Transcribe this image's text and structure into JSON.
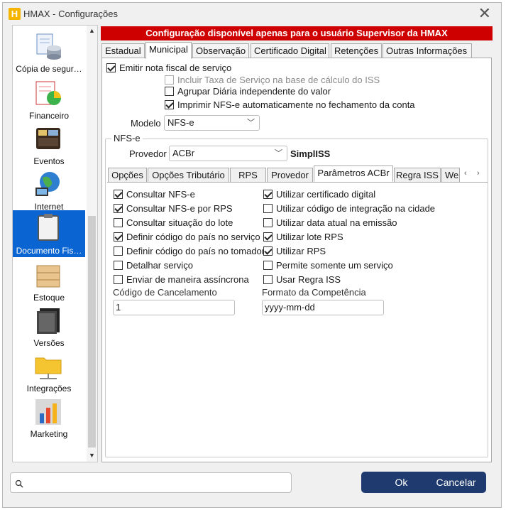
{
  "window": {
    "title": "HMAX - Configurações",
    "app_icon_letter": "H"
  },
  "sidebar": {
    "items": [
      {
        "label": "Cópia de segur…",
        "icon": "database-backup-icon"
      },
      {
        "label": "Financeiro",
        "icon": "finance-chart-icon"
      },
      {
        "label": "Eventos",
        "icon": "wallet-icon"
      },
      {
        "label": "Internet",
        "icon": "globe-computer-icon"
      },
      {
        "label": "Documento Fis…",
        "icon": "clipboard-icon",
        "active": true
      },
      {
        "label": "Estoque",
        "icon": "box-icon"
      },
      {
        "label": "Versões",
        "icon": "versions-icon"
      },
      {
        "label": "Integrações",
        "icon": "folder-network-icon"
      },
      {
        "label": "Marketing",
        "icon": "marketing-chart-icon"
      }
    ]
  },
  "banner": "Configuração disponível apenas para o usuário Supervisor da HMAX",
  "top_tabs": [
    "Estadual",
    "Municipal",
    "Observação",
    "Certificado Digital",
    "Retenções",
    "Outras Informações"
  ],
  "top_tabs_active": "Municipal",
  "municipal": {
    "emitir": {
      "label": "Emitir nota fiscal de serviço",
      "checked": true
    },
    "incluir_taxa": {
      "label": "Incluir Taxa de Serviço na base de cálculo do ISS",
      "checked": false,
      "disabled": true
    },
    "agrupar": {
      "label": "Agrupar Diária independente do valor",
      "checked": false
    },
    "imprimir": {
      "label": "Imprimir NFS-e automaticamente no fechamento da conta",
      "checked": true
    },
    "modelo_label": "Modelo",
    "modelo_value": "NFS-e"
  },
  "nfse": {
    "group_title": "NFS-e",
    "provedor_label": "Provedor",
    "provedor_value": "ACBr",
    "provedor_name": "SimplISS",
    "tabs": [
      "Opções",
      "Opções Tributário",
      "RPS",
      "Provedor",
      "Parâmetros ACBr",
      "Regra ISS",
      "We"
    ],
    "tabs_active": "Parâmetros ACBr",
    "left_checks": [
      {
        "label": "Consultar NFS-e",
        "checked": true
      },
      {
        "label": "Consultar NFS-e por RPS",
        "checked": true
      },
      {
        "label": "Consultar situação do lote",
        "checked": false
      },
      {
        "label": "Definir código do país no serviço",
        "checked": true
      },
      {
        "label": "Definir código do país no tomador",
        "checked": false
      },
      {
        "label": "Detalhar serviço",
        "checked": false
      },
      {
        "label": "Enviar de maneira assíncrona",
        "checked": false
      }
    ],
    "right_checks": [
      {
        "label": "Utilizar certificado digital",
        "checked": true
      },
      {
        "label": "Utilizar código de integração na cidade",
        "checked": false
      },
      {
        "label": "Utilizar data atual na emissão",
        "checked": false
      },
      {
        "label": "Utilizar lote RPS",
        "checked": true
      },
      {
        "label": "Utilizar RPS",
        "checked": true
      },
      {
        "label": "Permite somente um serviço",
        "checked": false
      },
      {
        "label": "Usar Regra ISS",
        "checked": false
      }
    ],
    "codigo_cancelamento_label": "Código de Cancelamento",
    "codigo_cancelamento_value": "1",
    "formato_competencia_label": "Formato da Competência",
    "formato_competencia_value": "yyyy-mm-dd"
  },
  "footer": {
    "search_placeholder": "",
    "ok_label": "Ok",
    "cancel_label": "Cancelar"
  }
}
